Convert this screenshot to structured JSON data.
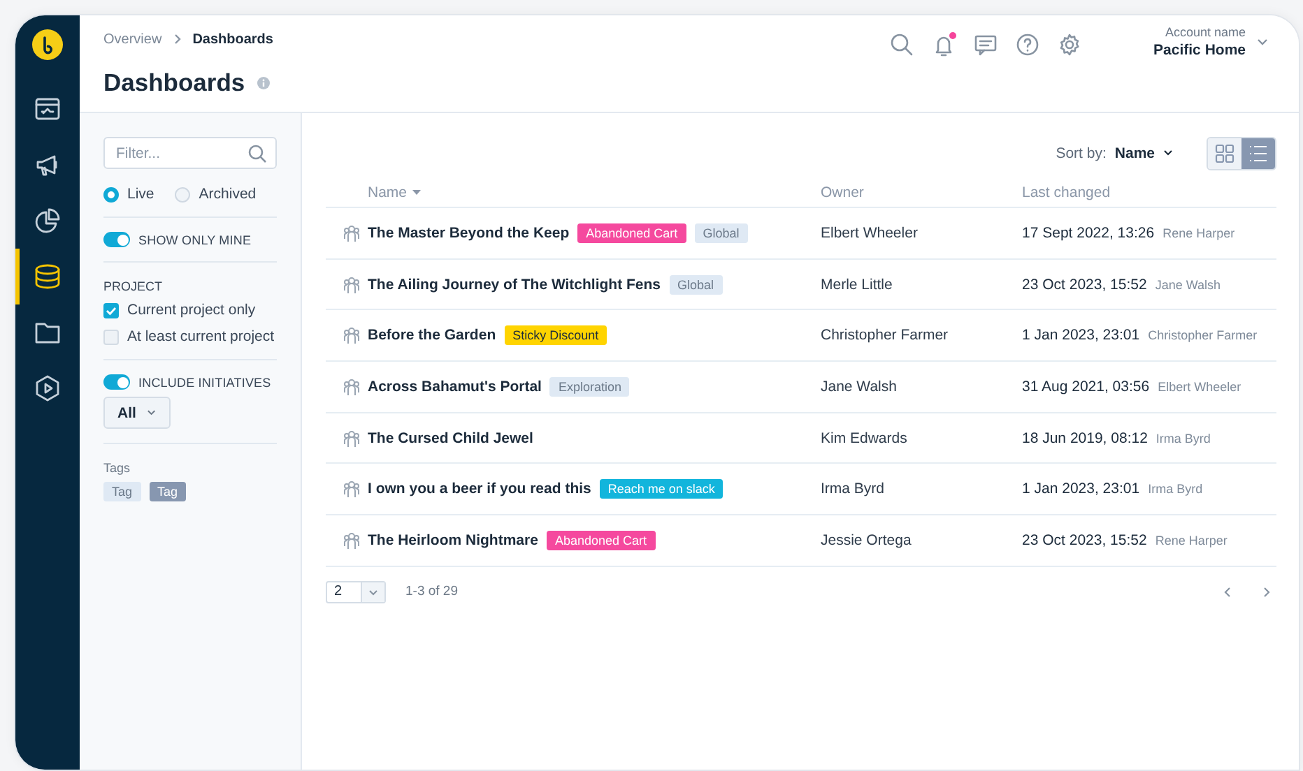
{
  "sidebar": {
    "nav": [
      {
        "kind": "dashboard",
        "selected": false
      },
      {
        "kind": "megaphone",
        "selected": false
      },
      {
        "kind": "pie",
        "selected": false
      },
      {
        "kind": "database",
        "selected": true
      },
      {
        "kind": "folder",
        "selected": false
      },
      {
        "kind": "play",
        "selected": false
      }
    ]
  },
  "header": {
    "breadcrumb": [
      {
        "label": "Overview"
      },
      {
        "label": "Dashboards"
      }
    ],
    "title": "Dashboards",
    "notifications_unread": true,
    "account": {
      "caption": "Account name",
      "name": "Pacific Home"
    }
  },
  "filters": {
    "search": {
      "placeholder": "Filter..."
    },
    "status": [
      {
        "label": "Live",
        "selected": true
      },
      {
        "label": "Archived",
        "selected": false
      }
    ],
    "show_only_mine": {
      "label": "SHOW ONLY MINE",
      "on": true
    },
    "project": {
      "heading": "PROJECT",
      "options": [
        {
          "label": "Current project only",
          "checked": true
        },
        {
          "label": "At least current project",
          "checked": false
        }
      ]
    },
    "include_initiatives": {
      "label": "INCLUDE INITIATIVES",
      "on": true
    },
    "initiatives_select": {
      "value": "All"
    },
    "tags": {
      "heading": "Tags",
      "items": [
        {
          "label": "Tag",
          "selected": false
        },
        {
          "label": "Tag",
          "selected": true
        }
      ]
    }
  },
  "table": {
    "sort": {
      "label": "Sort by:",
      "value": "Name"
    },
    "view_modes": [
      {
        "kind": "grid",
        "selected": false
      },
      {
        "kind": "list",
        "selected": true
      }
    ],
    "columns": [
      {
        "label": "Name",
        "sorted": true
      },
      {
        "label": "Owner",
        "sorted": false
      },
      {
        "label": "Last changed",
        "sorted": false
      }
    ],
    "rows": [
      {
        "name": "The Master Beyond the Keep",
        "tags": [
          {
            "label": "Abandoned Cart",
            "color": "#f5499e"
          },
          {
            "label": "Global",
            "color": "#dfe9f4"
          }
        ],
        "owner": "Elbert Wheeler",
        "changed": "17 Sept 2022, 13:26",
        "changed_by": "Rene Harper"
      },
      {
        "name": "The Ailing Journey of The Witchlight Fens",
        "tags": [
          {
            "label": "Global",
            "color": "#dfe9f4"
          }
        ],
        "owner": "Merle Little",
        "changed": "23 Oct 2023, 15:52",
        "changed_by": "Jane Walsh"
      },
      {
        "name": "Before the Garden",
        "tags": [
          {
            "label": "Sticky Discount",
            "color": "#ffd400"
          }
        ],
        "owner": "Christopher Farmer",
        "changed": "1 Jan 2023, 23:01",
        "changed_by": "Christopher Farmer"
      },
      {
        "name": "Across Bahamut's Portal",
        "tags": [
          {
            "label": "Exploration",
            "color": "#dfe9f4"
          }
        ],
        "owner": "Jane Walsh",
        "changed": "31 Aug 2021, 03:56",
        "changed_by": "Elbert Wheeler"
      },
      {
        "name": "The Cursed Child Jewel",
        "tags": [],
        "owner": "Kim Edwards",
        "changed": "18 Jun 2019, 08:12",
        "changed_by": "Irma Byrd"
      },
      {
        "name": "I own you a beer if you read this",
        "tags": [
          {
            "label": "Reach me on slack",
            "color": "#12b5dc"
          }
        ],
        "owner": "Irma Byrd",
        "changed": "1 Jan 2023, 23:01",
        "changed_by": "Irma Byrd"
      },
      {
        "name": "The Heirloom Nightmare",
        "tags": [
          {
            "label": "Abandoned Cart",
            "color": "#f5499e"
          }
        ],
        "owner": "Jessie Ortega",
        "changed": "23 Oct 2023, 15:52",
        "changed_by": "Rene Harper"
      }
    ]
  },
  "pagination": {
    "page_size": "2",
    "range": "1-3 of 29"
  }
}
